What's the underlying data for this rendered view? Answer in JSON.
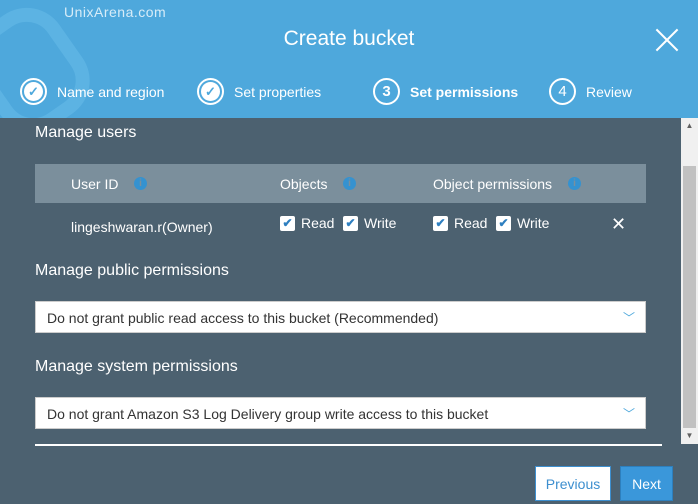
{
  "watermark": "UnixArena.com",
  "title": "Create bucket",
  "steps": [
    {
      "num": "✓",
      "label": "Name and region",
      "state": "done"
    },
    {
      "num": "✓",
      "label": "Set properties",
      "state": "done"
    },
    {
      "num": "3",
      "label": "Set permissions",
      "state": "active"
    },
    {
      "num": "4",
      "label": "Review",
      "state": "pending"
    }
  ],
  "manage_users": {
    "heading": "Manage users",
    "columns": [
      "User ID",
      "Objects",
      "Object permissions"
    ],
    "rows": [
      {
        "user": "lingeshwaran.r(Owner)",
        "objects_read": "Read",
        "objects_write": "Write",
        "perm_read": "Read",
        "perm_write": "Write"
      }
    ]
  },
  "public": {
    "heading": "Manage public permissions",
    "value": "Do not grant public read access to this bucket (Recommended)"
  },
  "system": {
    "heading": "Manage system permissions",
    "value": "Do not grant Amazon S3 Log Delivery group write access to this bucket"
  },
  "buttons": {
    "previous": "Previous",
    "next": "Next"
  },
  "colors": {
    "header": "#4ea8dc",
    "body": "#4c6170",
    "accent": "#3a97da"
  }
}
